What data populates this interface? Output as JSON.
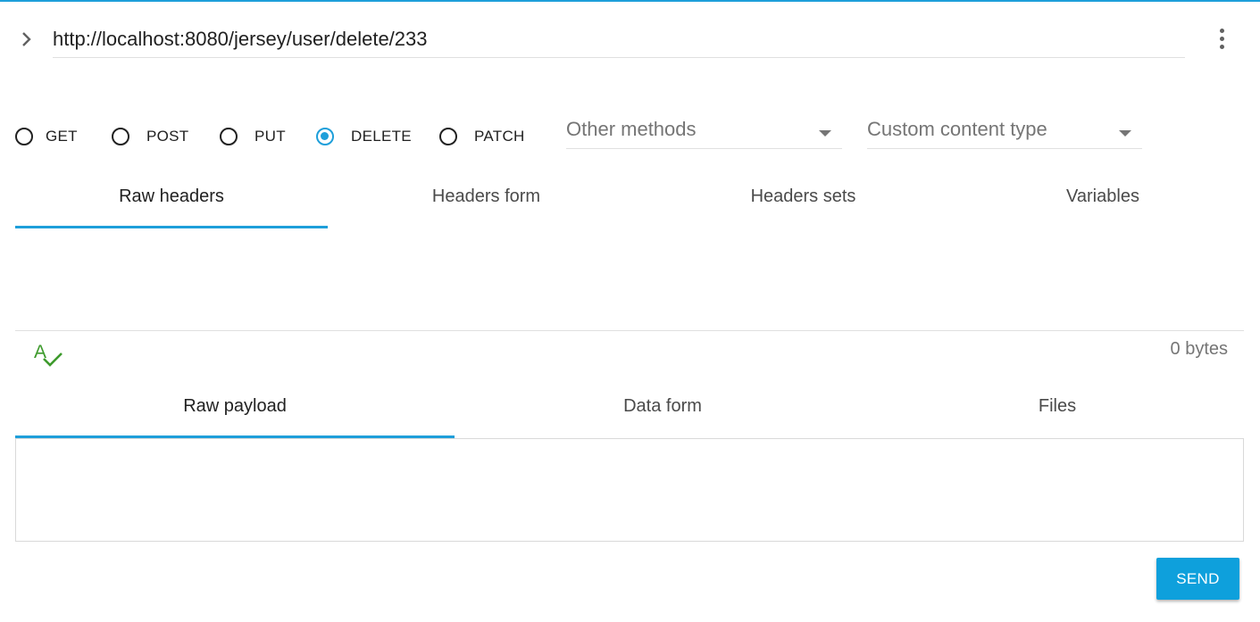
{
  "request": {
    "url": "http://localhost:8080/jersey/user/delete/233",
    "methods": [
      {
        "label": "GET",
        "checked": false
      },
      {
        "label": "POST",
        "checked": false
      },
      {
        "label": "PUT",
        "checked": false
      },
      {
        "label": "DELETE",
        "checked": true
      },
      {
        "label": "PATCH",
        "checked": false
      }
    ],
    "other_methods_placeholder": "Other methods",
    "content_type_placeholder": "Custom content type"
  },
  "headers_tabs": [
    {
      "label": "Raw headers",
      "active": true
    },
    {
      "label": "Headers form",
      "active": false
    },
    {
      "label": "Headers sets",
      "active": false
    },
    {
      "label": "Variables",
      "active": false
    }
  ],
  "headers_editor": {
    "value": "",
    "size_label": "0 bytes"
  },
  "payload_tabs": [
    {
      "label": "Raw payload",
      "active": true
    },
    {
      "label": "Data form",
      "active": false
    },
    {
      "label": "Files",
      "active": false
    }
  ],
  "payload_editor": {
    "value": ""
  },
  "actions": {
    "send_label": "SEND"
  },
  "colors": {
    "accent": "#1e9fda",
    "spellcheck": "#3d9a2c",
    "send_bg": "#0ea0dc"
  },
  "icons": {
    "expand": "chevron-right-icon",
    "menu": "more-vert-icon",
    "spellcheck": "spellcheck-icon"
  }
}
